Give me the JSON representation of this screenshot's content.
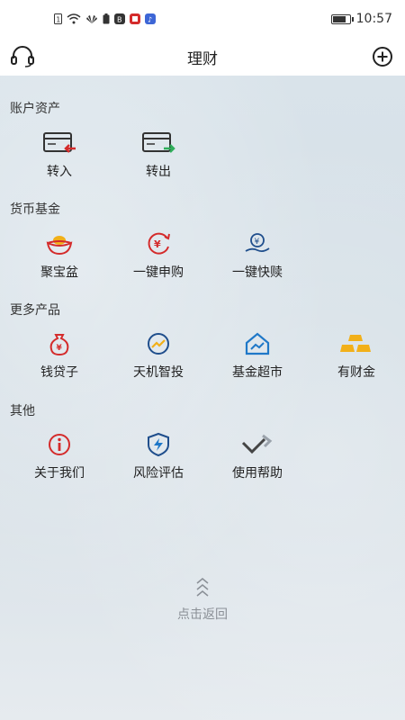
{
  "status": {
    "time": "10:57"
  },
  "nav": {
    "title": "理财"
  },
  "sections": {
    "account": {
      "title": "账户资产",
      "items": [
        {
          "label": "转入",
          "icon": "card-in-icon"
        },
        {
          "label": "转出",
          "icon": "card-out-icon"
        }
      ]
    },
    "money_fund": {
      "title": "货币基金",
      "items": [
        {
          "label": "聚宝盆",
          "icon": "treasure-bowl-icon"
        },
        {
          "label": "一键申购",
          "icon": "yen-subscribe-icon"
        },
        {
          "label": "一键快赎",
          "icon": "yen-redeem-icon"
        }
      ]
    },
    "more_products": {
      "title": "更多产品",
      "items": [
        {
          "label": "钱贷子",
          "icon": "money-bag-icon"
        },
        {
          "label": "天机智投",
          "icon": "trend-icon"
        },
        {
          "label": "基金超市",
          "icon": "house-chart-icon"
        },
        {
          "label": "有财金",
          "icon": "gold-bars-icon"
        }
      ]
    },
    "other": {
      "title": "其他",
      "items": [
        {
          "label": "关于我们",
          "icon": "info-icon"
        },
        {
          "label": "风险评估",
          "icon": "shield-bolt-icon"
        },
        {
          "label": "使用帮助",
          "icon": "help-diamond-icon"
        }
      ]
    }
  },
  "back": {
    "label": "点击返回"
  },
  "colors": {
    "red": "#d42b2b",
    "green": "#2fae5b",
    "blue": "#1f78c8",
    "gold": "#f2b019"
  }
}
